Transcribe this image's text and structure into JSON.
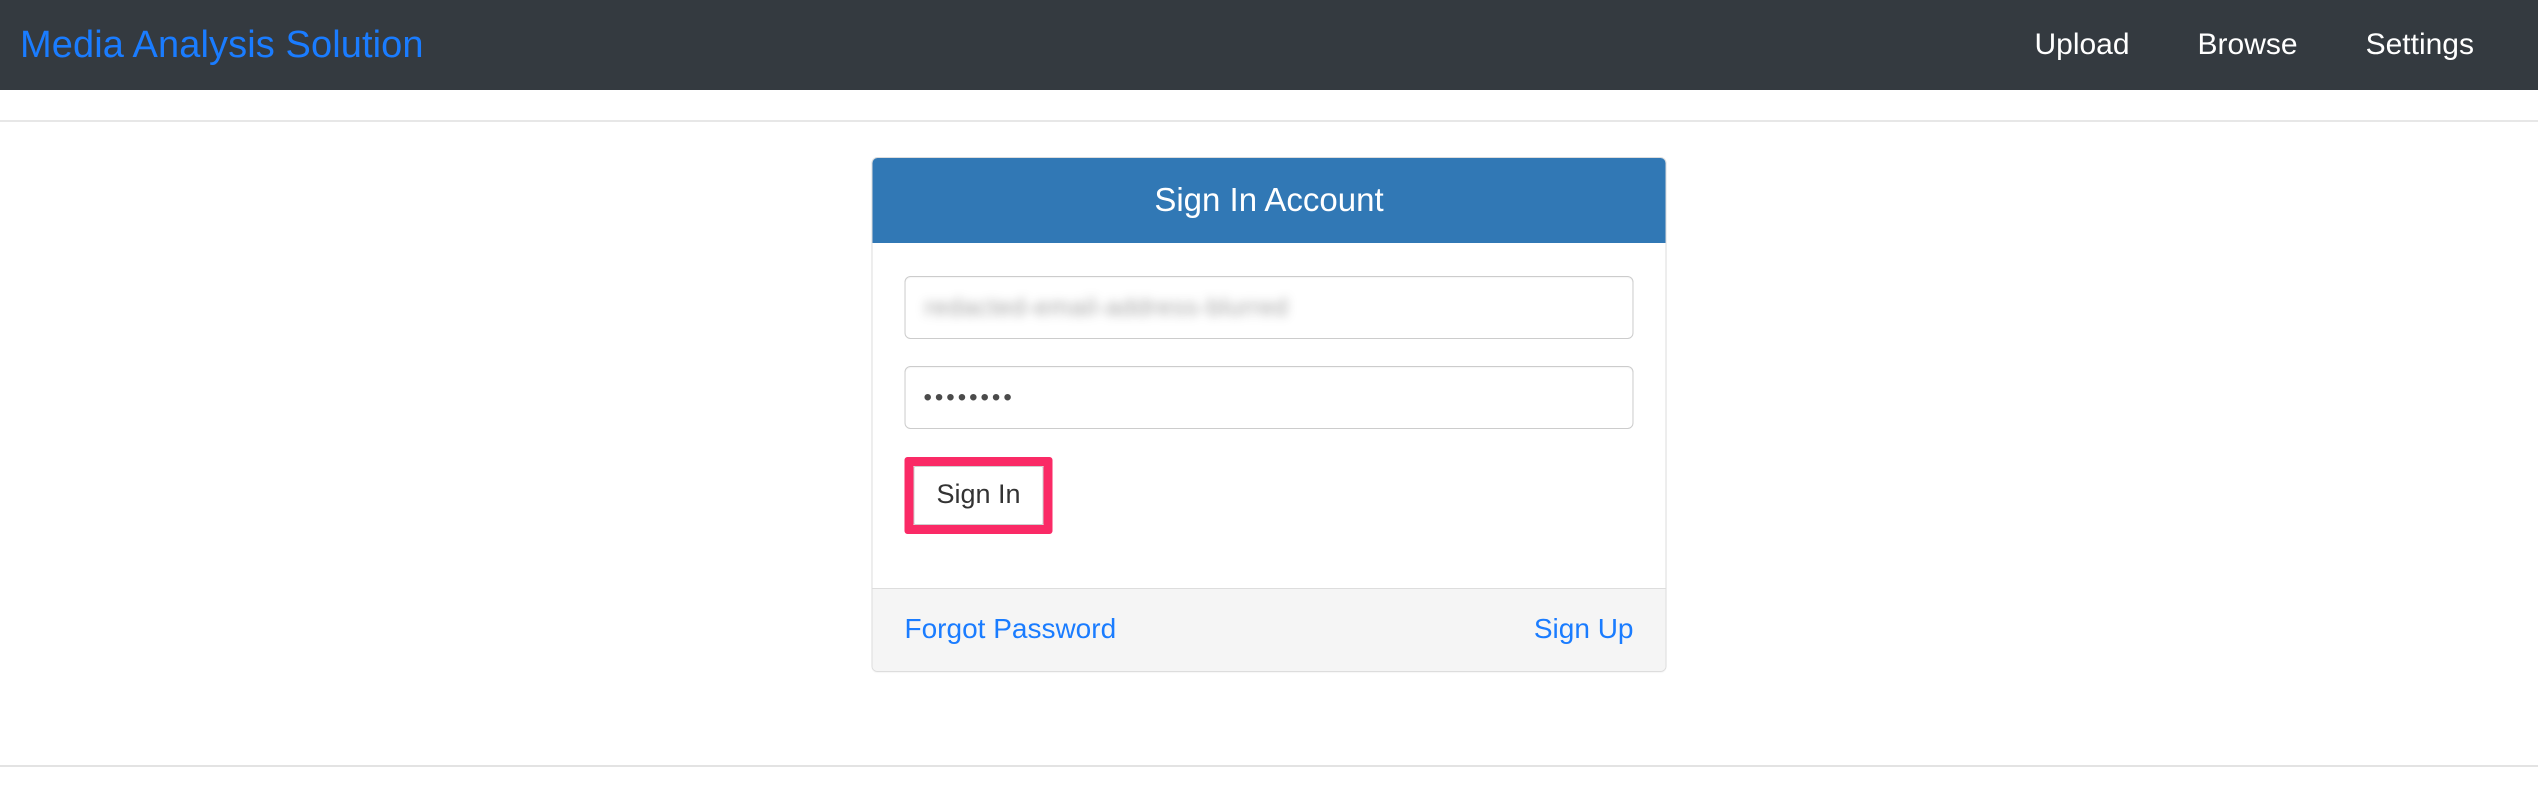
{
  "navbar": {
    "brand": "Media Analysis Solution",
    "brand_color": "#1a7cff",
    "background_color": "#343a40",
    "links": [
      {
        "label": "Upload",
        "name": "nav-link-upload"
      },
      {
        "label": "Browse",
        "name": "nav-link-browse"
      },
      {
        "label": "Settings",
        "name": "nav-link-settings"
      }
    ]
  },
  "card": {
    "header_title": "Sign In Account",
    "header_color": "#3178b5",
    "form": {
      "username": {
        "value": "redacted-email-address-blurred",
        "placeholder": "Username",
        "redacted": true
      },
      "password": {
        "value": "••••••••",
        "placeholder": "Password",
        "masked_char_count": 8
      },
      "submit_label": "Sign In"
    },
    "footer": {
      "forgot_password_label": "Forgot Password",
      "sign_up_label": "Sign Up",
      "link_color": "#1a7cff",
      "background_color": "#f5f5f5"
    }
  },
  "annotation": {
    "target": "Sign In",
    "highlight_color": "#fa2a66",
    "border_width_px": 9
  }
}
